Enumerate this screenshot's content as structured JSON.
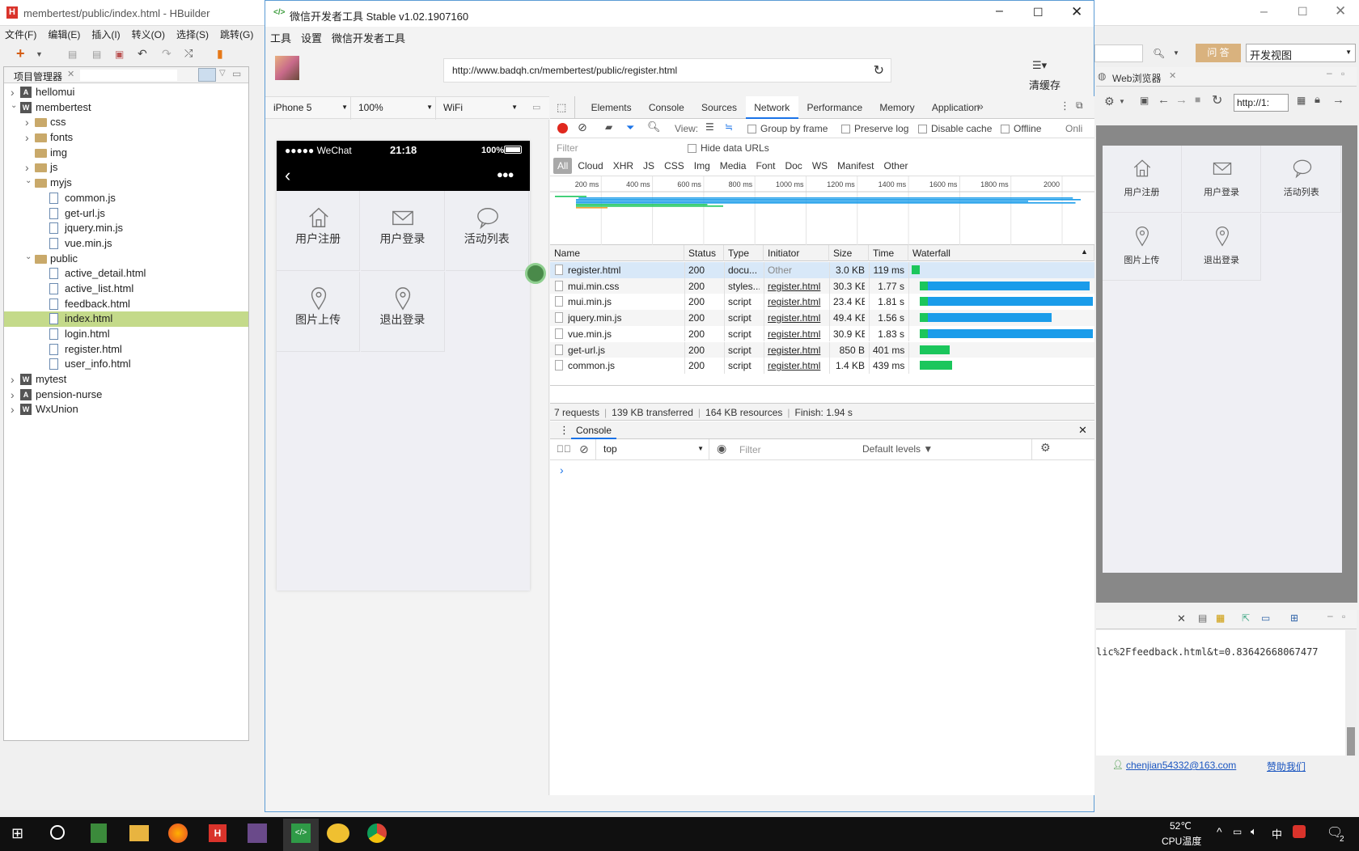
{
  "hbuilder": {
    "title": "membertest/public/index.html - HBuilder",
    "menu": [
      "文件(F)",
      "编辑(E)",
      "插入(I)",
      "转义(O)",
      "选择(S)",
      "跳转(G)"
    ],
    "panel_tab": "项目管理器",
    "tree": [
      {
        "label": "hellomui",
        "depth": 0,
        "kind": "proj-a",
        "state": "closed"
      },
      {
        "label": "membertest",
        "depth": 0,
        "kind": "proj-w",
        "state": "open"
      },
      {
        "label": "css",
        "depth": 1,
        "kind": "folder",
        "state": "closed"
      },
      {
        "label": "fonts",
        "depth": 1,
        "kind": "folder",
        "state": "closed"
      },
      {
        "label": "img",
        "depth": 1,
        "kind": "folder",
        "state": "none"
      },
      {
        "label": "js",
        "depth": 1,
        "kind": "folder",
        "state": "closed"
      },
      {
        "label": "myjs",
        "depth": 1,
        "kind": "folder",
        "state": "open"
      },
      {
        "label": "common.js",
        "depth": 2,
        "kind": "file",
        "state": "none"
      },
      {
        "label": "get-url.js",
        "depth": 2,
        "kind": "file",
        "state": "none"
      },
      {
        "label": "jquery.min.js",
        "depth": 2,
        "kind": "file",
        "state": "none"
      },
      {
        "label": "vue.min.js",
        "depth": 2,
        "kind": "file",
        "state": "none"
      },
      {
        "label": "public",
        "depth": 1,
        "kind": "folder",
        "state": "open"
      },
      {
        "label": "active_detail.html",
        "depth": 2,
        "kind": "file",
        "state": "none"
      },
      {
        "label": "active_list.html",
        "depth": 2,
        "kind": "file",
        "state": "none"
      },
      {
        "label": "feedback.html",
        "depth": 2,
        "kind": "file",
        "state": "none"
      },
      {
        "label": "index.html",
        "depth": 2,
        "kind": "file",
        "state": "none",
        "selected": true
      },
      {
        "label": "login.html",
        "depth": 2,
        "kind": "file",
        "state": "none"
      },
      {
        "label": "register.html",
        "depth": 2,
        "kind": "file",
        "state": "none"
      },
      {
        "label": "user_info.html",
        "depth": 2,
        "kind": "file",
        "state": "none"
      },
      {
        "label": "mytest",
        "depth": 0,
        "kind": "proj-w",
        "state": "closed"
      },
      {
        "label": "pension-nurse",
        "depth": 0,
        "kind": "proj-a",
        "state": "closed"
      },
      {
        "label": "WxUnion",
        "depth": 0,
        "kind": "proj-w",
        "state": "closed"
      }
    ],
    "qa_button": "问 答",
    "view_select": "开发视图",
    "web_tab": "Web浏览器",
    "web_url": "http://1:",
    "web_tiles": [
      "用户注册",
      "用户登录",
      "活动列表",
      "图片上传",
      "退出登录"
    ],
    "log_text": "lic%2Ffeedback.html&t=0.83642668067477",
    "email": "chenjian54332@163.com",
    "sponsor": "赞助我们"
  },
  "wechat": {
    "title": "微信开发者工具 Stable v1.02.1907160",
    "menu": [
      "工具",
      "设置",
      "微信开发者工具"
    ],
    "url": "http://www.badqh.cn/membertest/public/register.html",
    "clear_cache": "清缓存",
    "device": "iPhone 5",
    "zoom": "100%",
    "network": "WiFi",
    "phone": {
      "carrier": "●●●●● WeChat",
      "time": "21:18",
      "battery": "100%",
      "tiles": [
        "用户注册",
        "用户登录",
        "活动列表",
        "图片上传",
        "退出登录"
      ]
    }
  },
  "devtools": {
    "tabs": [
      "Elements",
      "Console",
      "Sources",
      "Network",
      "Performance",
      "Memory",
      "Application"
    ],
    "active_tab": "Network",
    "toolbar": {
      "view_label": "View:",
      "group_by_frame": "Group by frame",
      "preserve_log": "Preserve log",
      "disable_cache": "Disable cache",
      "offline": "Offline",
      "online": "Onli"
    },
    "filter_placeholder": "Filter",
    "hide_data_urls": "Hide data URLs",
    "type_filters": [
      "All",
      "Cloud",
      "XHR",
      "JS",
      "CSS",
      "Img",
      "Media",
      "Font",
      "Doc",
      "WS",
      "Manifest",
      "Other"
    ],
    "timeline_ticks": [
      "200 ms",
      "400 ms",
      "600 ms",
      "800 ms",
      "1000 ms",
      "1200 ms",
      "1400 ms",
      "1600 ms",
      "1800 ms",
      "2000"
    ],
    "columns": [
      "Name",
      "Status",
      "Type",
      "Initiator",
      "Size",
      "Time",
      "Waterfall"
    ],
    "requests": [
      {
        "name": "register.html",
        "status": "200",
        "type": "docu...",
        "initiator": "Other",
        "size": "3.0 KB",
        "time": "119 ms",
        "wait": 0.0,
        "recv": 0.07,
        "recv_color": "#1bc65c"
      },
      {
        "name": "mui.min.css",
        "status": "200",
        "type": "styles...",
        "initiator": "register.html",
        "size": "30.3 KB",
        "time": "1.77 s",
        "wait": 0.07,
        "recv": 0.9,
        "recv_color": "#1a9cea"
      },
      {
        "name": "mui.min.js",
        "status": "200",
        "type": "script",
        "initiator": "register.html",
        "size": "23.4 KB",
        "time": "1.81 s",
        "wait": 0.07,
        "recv": 0.92,
        "recv_color": "#1a9cea"
      },
      {
        "name": "jquery.min.js",
        "status": "200",
        "type": "script",
        "initiator": "register.html",
        "size": "49.4 KB",
        "time": "1.56 s",
        "wait": 0.2,
        "recv": 0.69,
        "recv_color": "#1a9cea"
      },
      {
        "name": "vue.min.js",
        "status": "200",
        "type": "script",
        "initiator": "register.html",
        "size": "30.9 KB",
        "time": "1.83 s",
        "wait": 0.1,
        "recv": 0.92,
        "recv_color": "#1a9cea"
      },
      {
        "name": "get-url.js",
        "status": "200",
        "type": "script",
        "initiator": "register.html",
        "size": "850 B",
        "time": "401 ms",
        "wait": 0.22,
        "recv": 0.0,
        "recv_color": "#1a9cea"
      },
      {
        "name": "common.js",
        "status": "200",
        "type": "script",
        "initiator": "register.html",
        "size": "1.4 KB",
        "time": "439 ms",
        "wait": 0.24,
        "recv": 0.0,
        "recv_color": "#1a9cea"
      }
    ],
    "summary": [
      "7 requests",
      "139 KB transferred",
      "164 KB resources",
      "Finish: 1.94 s"
    ],
    "console": {
      "tab": "Console",
      "context": "top",
      "filter_placeholder": "Filter",
      "levels": "Default levels ▼",
      "prompt": "›"
    }
  },
  "taskbar": {
    "temp": "52℃",
    "temp_label": "CPU温度",
    "ime": "中",
    "notif_count": "2"
  }
}
